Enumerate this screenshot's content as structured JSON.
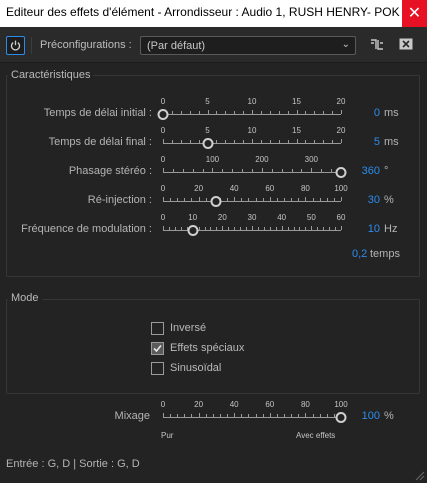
{
  "window": {
    "title": "Editeur des effets d'élément - Arrondisseur : Audio 1, RUSH HENRY- POKER 1",
    "close": "✕"
  },
  "toolbar": {
    "power_icon": "power-icon",
    "presets_label": "Préconfigurations :",
    "presets_value": "(Par défaut)"
  },
  "characteristics": {
    "title": "Caractéristiques",
    "rows": [
      {
        "label": "Temps de délai initial :",
        "ticks": [
          "0",
          "5",
          "10",
          "15",
          "20"
        ],
        "min": 0,
        "max": 20,
        "value": 0,
        "value_text": "0",
        "unit": "ms"
      },
      {
        "label": "Temps de délai final :",
        "ticks": [
          "0",
          "5",
          "10",
          "15",
          "20"
        ],
        "min": 0,
        "max": 20,
        "value": 5,
        "value_text": "5",
        "unit": "ms"
      },
      {
        "label": "Phasage stéréo :",
        "ticks": [
          "0",
          "100",
          "200",
          "300"
        ],
        "min": 0,
        "max": 360,
        "value": 360,
        "value_text": "360",
        "unit": "°"
      },
      {
        "label": "Ré-injection :",
        "ticks": [
          "0",
          "20",
          "40",
          "60",
          "80",
          "100"
        ],
        "min": 0,
        "max": 100,
        "value": 30,
        "value_text": "30",
        "unit": "%"
      },
      {
        "label": "Fréquence de modulation :",
        "ticks": [
          "0",
          "10",
          "20",
          "30",
          "40",
          "50",
          "60"
        ],
        "min": 0,
        "max": 60,
        "value": 10,
        "value_text": "10",
        "unit": "Hz"
      }
    ],
    "voices": {
      "value": "0,2",
      "unit": "temps"
    }
  },
  "mode": {
    "title": "Mode",
    "options": [
      {
        "label": "Inversé",
        "checked": false
      },
      {
        "label": "Effets spéciaux",
        "checked": true
      },
      {
        "label": "Sinusoïdal",
        "checked": false
      }
    ]
  },
  "mix": {
    "label": "Mixage",
    "ticks": [
      "0",
      "20",
      "40",
      "60",
      "80",
      "100"
    ],
    "min": 0,
    "max": 100,
    "value": 100,
    "value_text": "100",
    "unit": "%",
    "left_end": "Pur",
    "right_end": "Avec effets"
  },
  "footer": {
    "io": "Entrée : G, D | Sortie : G, D"
  }
}
